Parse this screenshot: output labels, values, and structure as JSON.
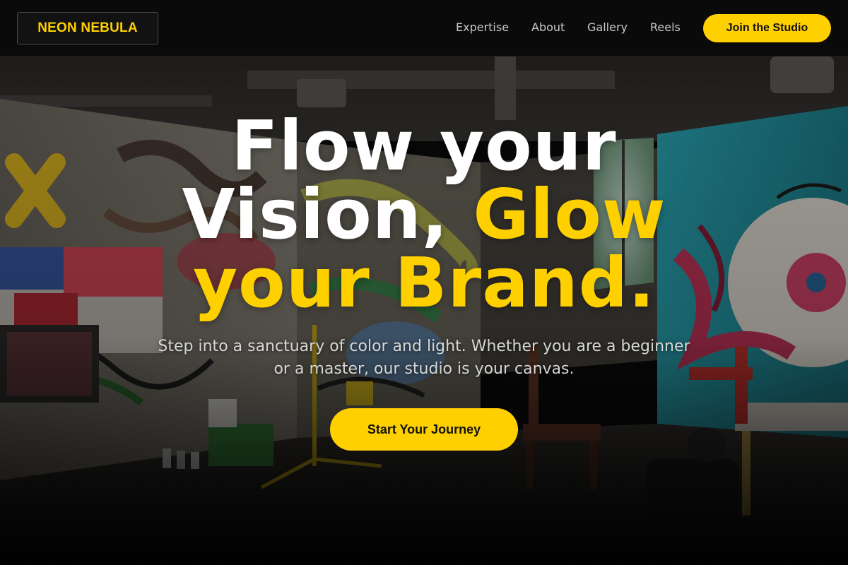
{
  "brand": {
    "name": "NEON NEBULA"
  },
  "nav": {
    "items": [
      "Expertise",
      "About",
      "Gallery",
      "Reels"
    ],
    "cta_label": "Join the Studio"
  },
  "hero": {
    "headline": {
      "line1": "Flow your",
      "line2_white": "Vision,",
      "line2_accent": "Glow",
      "line3_accent": "your Brand."
    },
    "subtext_line1": "Step into a sanctuary of color and light. Whether you are a beginner",
    "subtext_line2": "or a master, our studio is your canvas.",
    "cta_label": "Start Your Journey",
    "background_image": "graffiti-studio-photo"
  },
  "colors": {
    "accent": "#ffd000",
    "header_bg": "#0a0a0a",
    "text_white": "#ffffff",
    "nav_text": "#c9c9c9"
  }
}
